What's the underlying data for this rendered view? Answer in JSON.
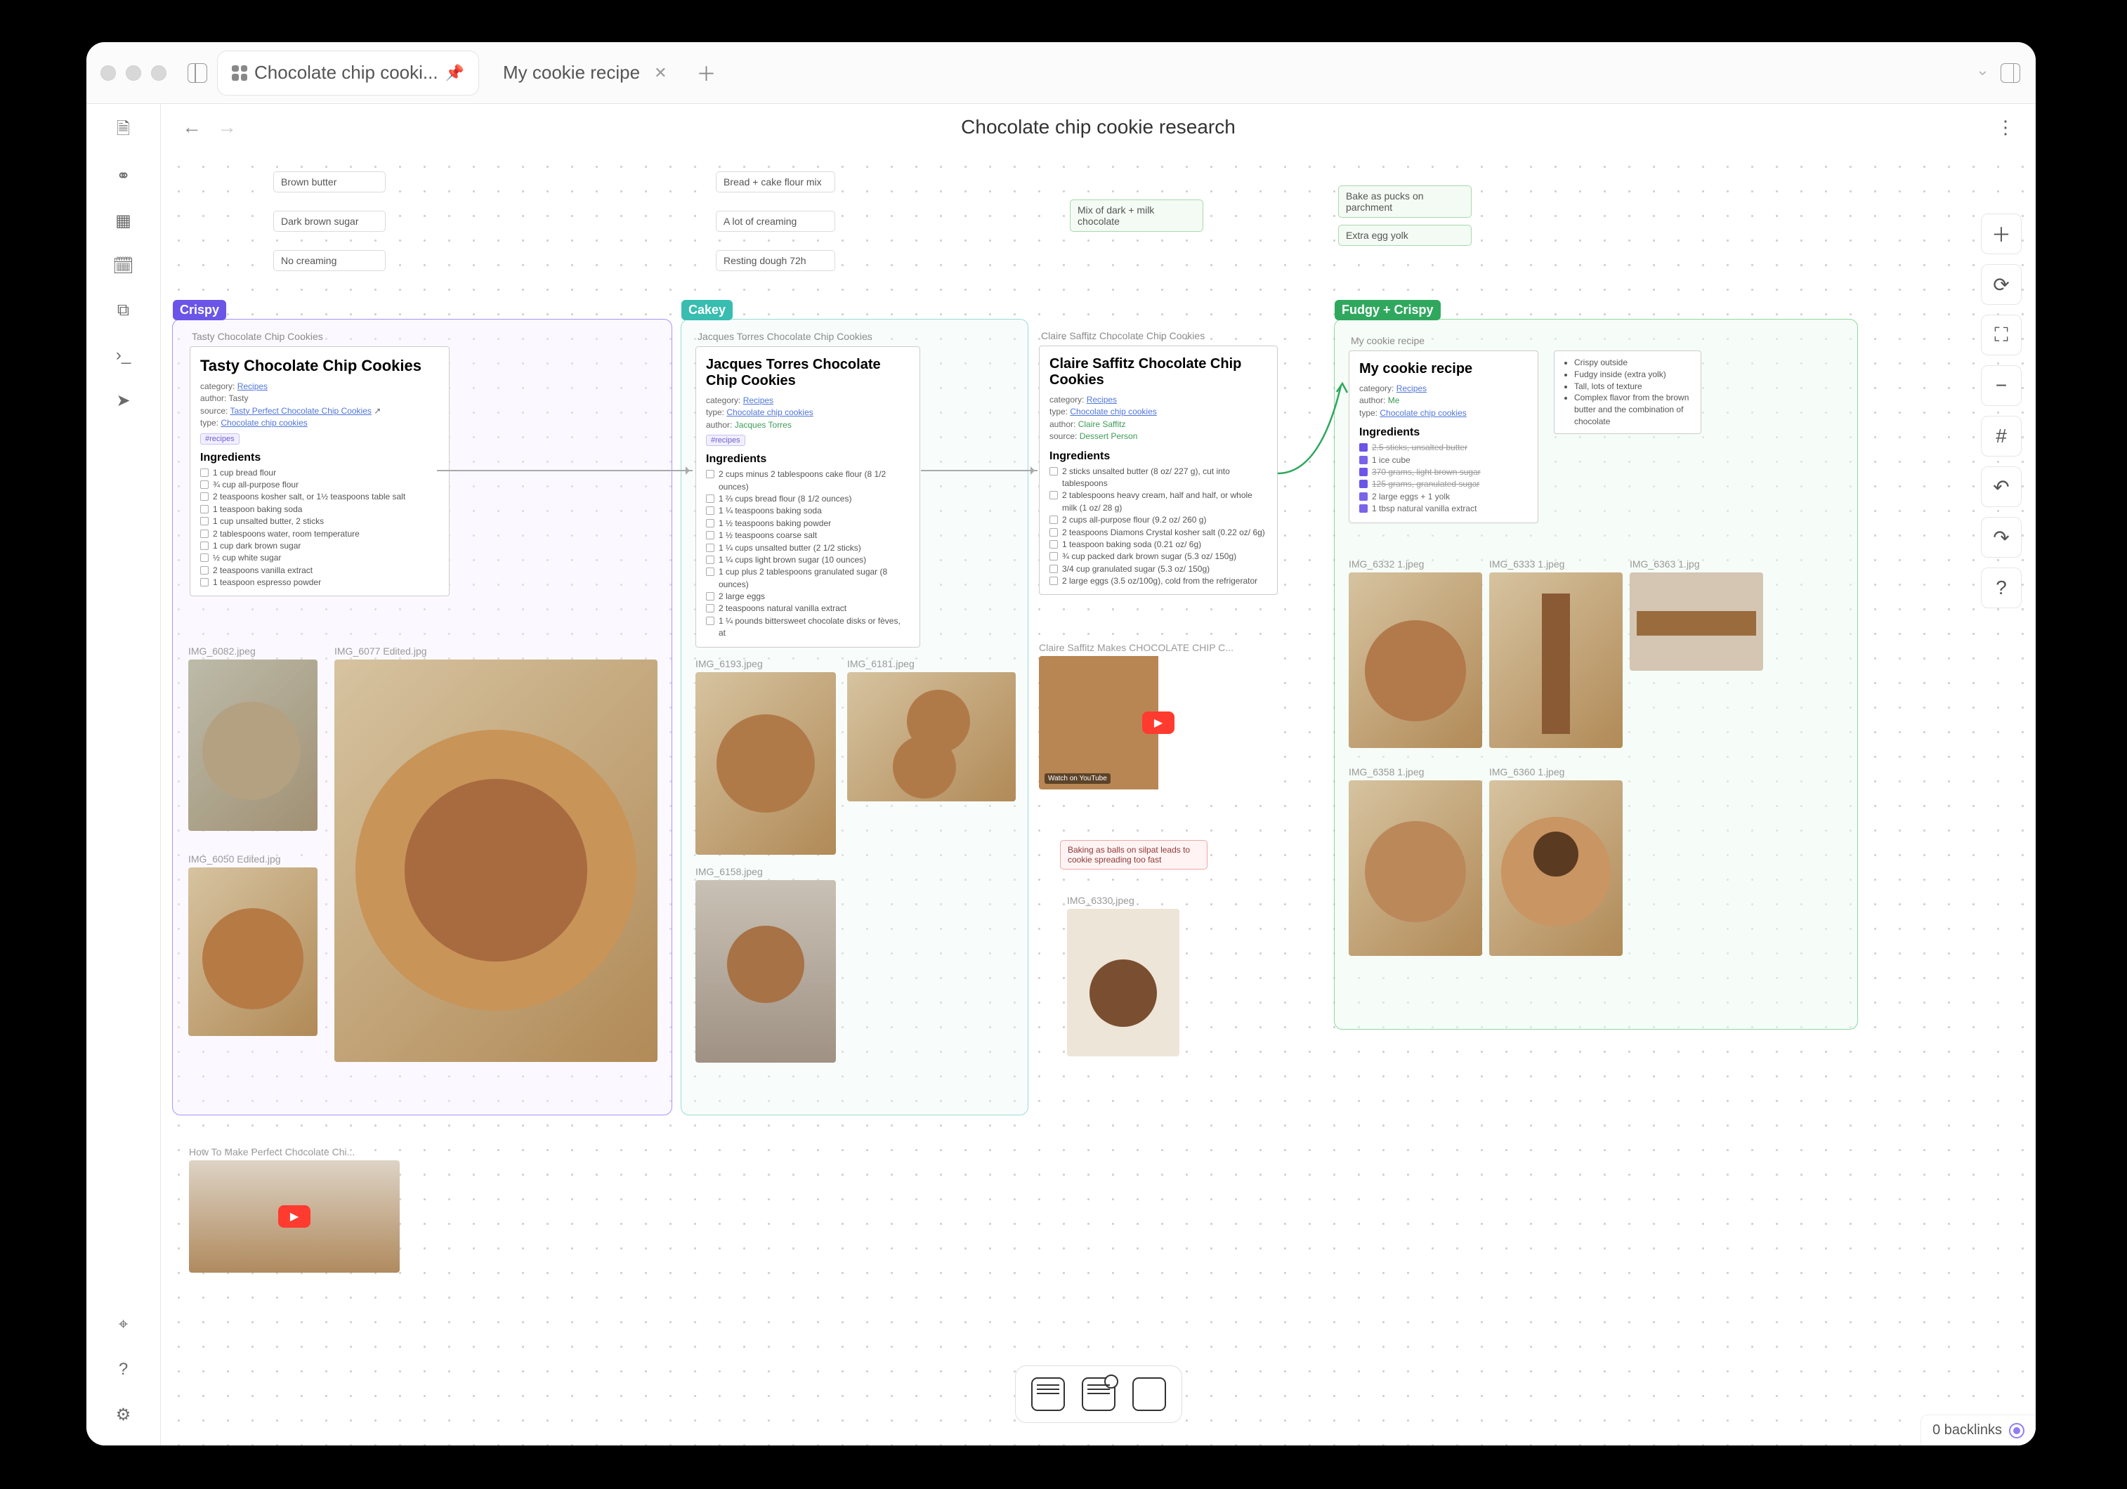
{
  "tabs": [
    {
      "label": "Chocolate chip cooki...",
      "pinned": true,
      "active": true
    },
    {
      "label": "My cookie recipe",
      "pinned": false,
      "active": false
    }
  ],
  "documentTitle": "Chocolate chip cookie research",
  "leftRail": [
    "file-icon",
    "graph-icon",
    "grid-icon",
    "calendar-icon",
    "copy-icon",
    "terminal-icon",
    "send-icon"
  ],
  "leftRailBottom": [
    "shield-icon",
    "help-icon",
    "settings-icon"
  ],
  "rightTools": [
    "plus-icon",
    "refresh-icon",
    "expand-icon",
    "minus-icon",
    "grid-icon",
    "undo-icon",
    "redo-icon",
    "help-icon"
  ],
  "floatingNotes": {
    "col1": [
      "Brown butter",
      "Dark brown sugar",
      "No creaming"
    ],
    "col2": [
      "Bread + cake flour mix",
      "A lot of creaming",
      "Resting dough 72h"
    ],
    "col3": [
      "Mix of dark + milk chocolate"
    ],
    "col4": [
      "Bake as pucks on parchment",
      "Extra egg yolk"
    ]
  },
  "sections": {
    "crispy": {
      "label": "Crispy",
      "card": {
        "header": "Tasty Chocolate Chip Cookies",
        "title": "Tasty Chocolate Chip Cookies",
        "meta": {
          "category": "Recipes",
          "author": "Tasty",
          "source": "Tasty Perfect Chocolate Chip Cookies",
          "type": "Chocolate chip cookies"
        },
        "tag": "#recipes",
        "ingredientsHeading": "Ingredients",
        "ingredients": [
          "1 cup bread flour",
          "¾ cup all-purpose flour",
          "2 teaspoons kosher salt, or 1½ teaspoons table salt",
          "1 teaspoon baking soda",
          "1 cup unsalted butter, 2 sticks",
          "2 tablespoons water, room temperature",
          "1 cup dark brown sugar",
          "½ cup white sugar",
          "2 teaspoons vanilla extract",
          "1 teaspoon espresso powder"
        ]
      },
      "images": [
        "IMG_6082.jpeg",
        "IMG_6077 Edited.jpg",
        "IMG_6050 Edited.jpg"
      ],
      "videoBelow": {
        "header": "How To Make Perfect Chocolate Chi..."
      }
    },
    "cakey": {
      "label": "Cakey",
      "cards": [
        {
          "header": "Jacques Torres Chocolate Chip Cookies",
          "title": "Jacques Torres Chocolate Chip Cookies",
          "meta": {
            "category": "Recipes",
            "type": "Chocolate chip cookies",
            "author": "Jacques Torres"
          },
          "tag": "#recipes",
          "ingredientsHeading": "Ingredients",
          "ingredients": [
            "2 cups minus 2 tablespoons cake flour (8 1/2 ounces)",
            "1 ⅔ cups bread flour (8 1/2 ounces)",
            "1 ¼ teaspoons baking soda",
            "1 ½ teaspoons baking powder",
            "1 ½ teaspoons coarse salt",
            "1 ¼ cups unsalted butter (2 1/2 sticks)",
            "1 ¼ cups light brown sugar (10 ounces)",
            "1 cup plus 2 tablespoons granulated sugar (8 ounces)",
            "2 large eggs",
            "2 teaspoons natural vanilla extract",
            "1 ¼ pounds bittersweet chocolate disks or fèves, at"
          ]
        },
        {
          "header": "Claire Saffitz Chocolate Chip Cookies",
          "title": "Claire Saffitz Chocolate Chip Cookies",
          "meta": {
            "category": "Recipes",
            "type": "Chocolate chip cookies",
            "author": "Claire Saffitz",
            "source": "Dessert Person"
          },
          "ingredientsHeading": "Ingredients",
          "ingredients": [
            "2 sticks unsalted butter (8 oz/ 227 g), cut into tablespoons",
            "2 tablespoons heavy cream, half and half, or whole milk (1 oz/ 28 g)",
            "2 cups all-purpose flour (9.2 oz/ 260 g)",
            "2 teaspoons Diamons Crystal kosher salt (0.22 oz/ 6g)",
            "1 teaspoon baking soda (0.21 oz/ 6g)",
            "¾ cup packed dark brown sugar (5.3 oz/ 150g)",
            "3/4 cup granulated sugar (5.3 oz/ 150g)",
            "2 large eggs (3.5 oz/100g), cold from the refrigerator"
          ]
        }
      ],
      "images": [
        "IMG_6193.jpeg",
        "IMG_6181.jpeg",
        "IMG_6158.jpeg"
      ],
      "video": {
        "header": "Claire Saffitz Makes CHOCOLATE CHIP C...",
        "badge": "Watch on YouTube"
      },
      "redNote": "Baking as balls on silpat leads to cookie spreading too fast",
      "imageBelow": "IMG_6330.jpeg"
    },
    "fudgy": {
      "label": "Fudgy + Crispy",
      "card": {
        "header": "My cookie recipe",
        "title": "My cookie recipe",
        "meta": {
          "category": "Recipes",
          "author": "Me",
          "type": "Chocolate chip cookies"
        },
        "ingredientsHeading": "Ingredients",
        "ingredients": [
          {
            "text": "2.5 sticks, unsalted butter",
            "done": true
          },
          {
            "text": "1 ice cube",
            "done": false
          },
          {
            "text": "370 grams, light brown sugar",
            "done": true
          },
          {
            "text": "125 grams, granulated sugar",
            "done": true
          },
          {
            "text": "2 large eggs + 1 yolk",
            "done": false
          },
          {
            "text": "1 tbsp natural vanilla extract",
            "done": false
          }
        ]
      },
      "bullets": [
        "Crispy outside",
        "Fudgy inside (extra yolk)",
        "Tall, lots of texture",
        "Complex flavor from the brown butter and the combination of chocolate"
      ],
      "images": [
        "IMG_6332 1.jpeg",
        "IMG_6333 1.jpeg",
        "IMG_6363 1.jpg",
        "IMG_6358 1.jpeg",
        "IMG_6360 1.jpeg"
      ]
    }
  },
  "backlinks": "0 backlinks"
}
